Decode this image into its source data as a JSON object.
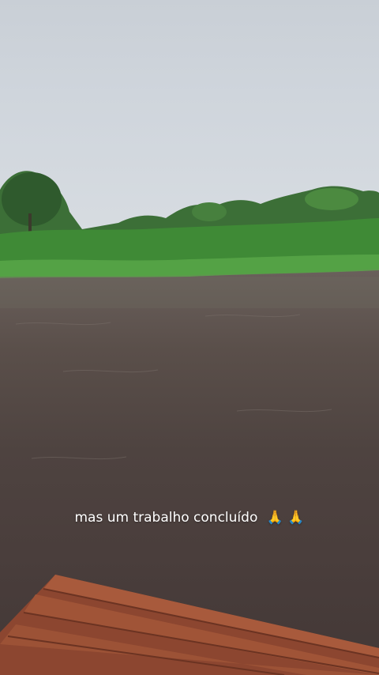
{
  "caption": {
    "text": "mas um trabalho concluído",
    "emoji": "🙏 🙏"
  },
  "colors": {
    "sky": "#cfd5dc",
    "vegetation": "#3f8a36",
    "water": "#4e4340",
    "deck": "#9a4f35"
  }
}
